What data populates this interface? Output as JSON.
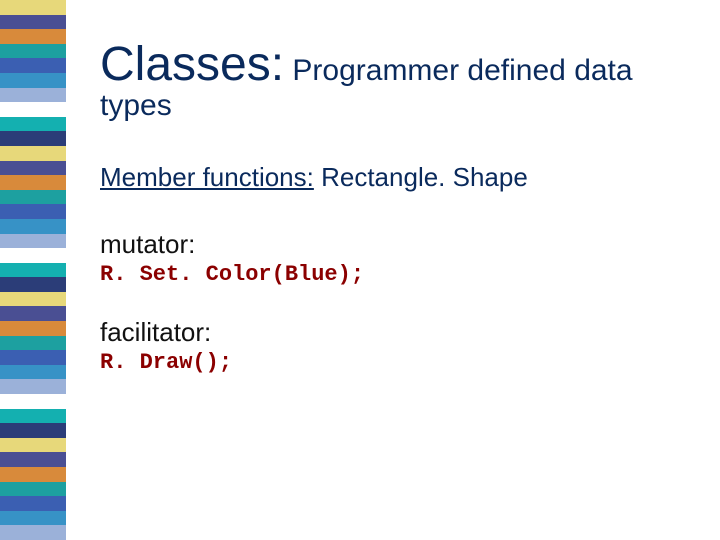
{
  "stripes": [
    "#e7d87a",
    "#4a4f93",
    "#d88a3b",
    "#1da0a0",
    "#3b5fb2",
    "#3792c6",
    "#9bb1d9",
    "#ffffff",
    "#14b0b0",
    "#2b3d78",
    "#e7d87a",
    "#4a4f93",
    "#d88a3b",
    "#1da0a0",
    "#3b5fb2",
    "#3792c6",
    "#9bb1d9",
    "#ffffff",
    "#14b0b0",
    "#2b3d78",
    "#e7d87a",
    "#4a4f93",
    "#d88a3b",
    "#1da0a0",
    "#3b5fb2",
    "#3792c6",
    "#9bb1d9",
    "#ffffff",
    "#14b0b0",
    "#2b3d78",
    "#e7d87a",
    "#4a4f93",
    "#d88a3b",
    "#1da0a0",
    "#3b5fb2",
    "#3792c6",
    "#9bb1d9"
  ],
  "title": {
    "big": "Classes:",
    "small": " Programmer defined data types"
  },
  "memberfn": {
    "label": "Member functions:",
    "rest": " Rectangle. Shape"
  },
  "mutator": {
    "label": "mutator:",
    "code": "R. Set. Color(Blue);"
  },
  "facilitator": {
    "label": "facilitator:",
    "code": "R. Draw();"
  }
}
